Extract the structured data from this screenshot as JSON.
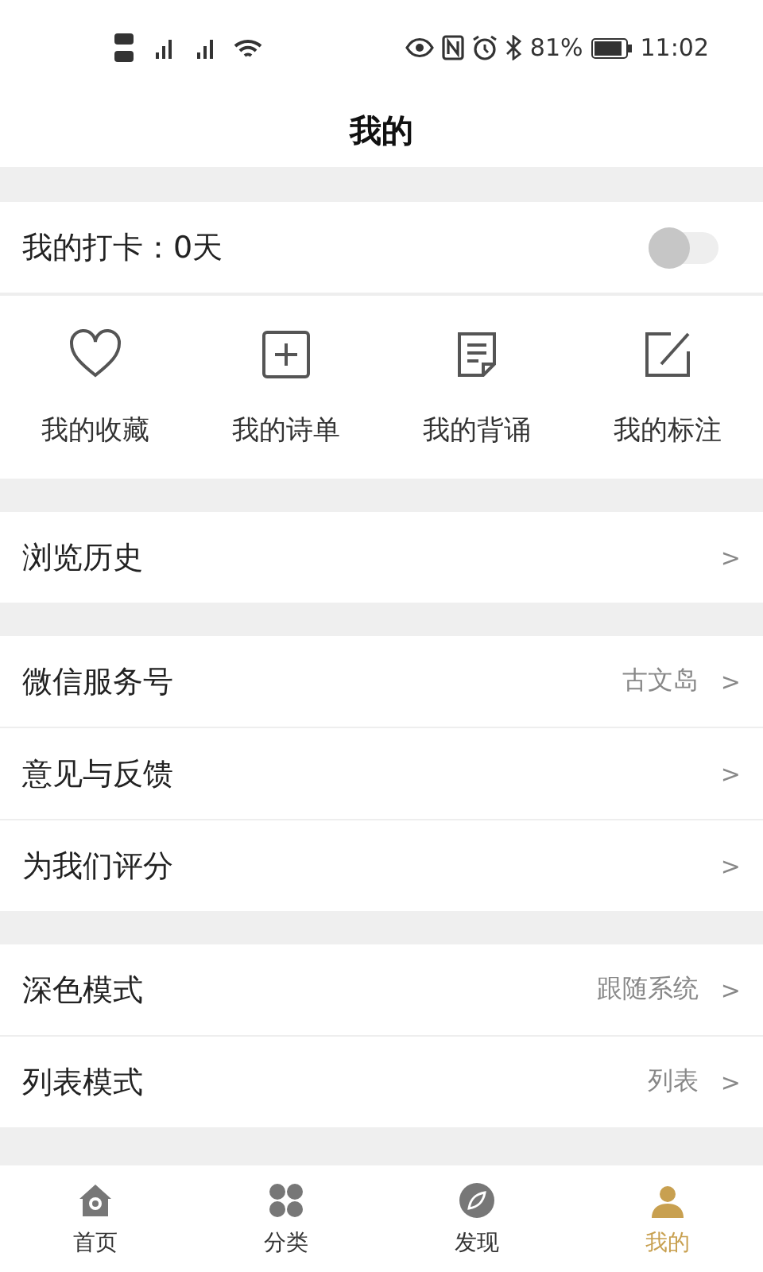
{
  "status_bar": {
    "battery": "81%",
    "time": "11:02"
  },
  "header": {
    "title": "我的"
  },
  "checkin": {
    "label": "我的打卡：0天",
    "on": false
  },
  "shortcuts": [
    {
      "kind": "heart",
      "label": "我的收藏"
    },
    {
      "kind": "plus",
      "label": "我的诗单"
    },
    {
      "kind": "doc",
      "label": "我的背诵"
    },
    {
      "kind": "edit",
      "label": "我的标注"
    }
  ],
  "groups": [
    [
      {
        "label": "浏览历史",
        "chevron": ">"
      }
    ],
    [
      {
        "label": "微信服务号",
        "value": "古文岛",
        "chevron": ">"
      },
      {
        "label": "意见与反馈",
        "chevron": ">"
      },
      {
        "label": "为我们评分",
        "chevron": ">"
      }
    ],
    [
      {
        "label": "深色模式",
        "value": "跟随系统",
        "chevron": ">"
      },
      {
        "label": "列表模式",
        "value": "列表",
        "chevron": ">"
      }
    ]
  ],
  "nav": [
    {
      "kind": "home",
      "label": "首页",
      "selected": false
    },
    {
      "kind": "grid",
      "label": "分类",
      "selected": false
    },
    {
      "kind": "compass",
      "label": "发现",
      "selected": false
    },
    {
      "kind": "user",
      "label": "我的",
      "selected": true
    }
  ]
}
